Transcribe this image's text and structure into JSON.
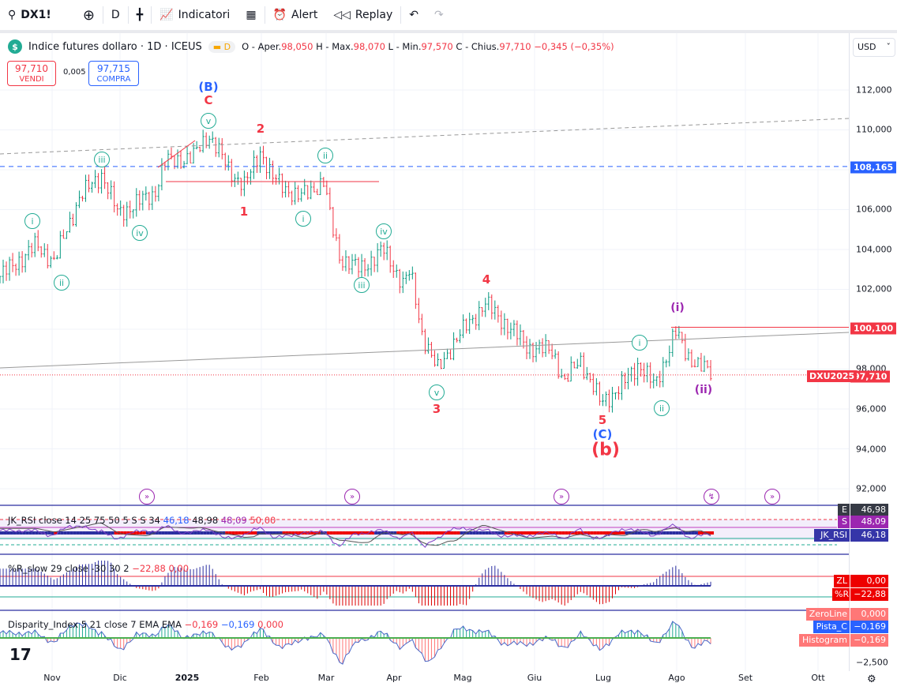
{
  "toolbar": {
    "symbol": "DX1!",
    "interval": "D",
    "indicators": "Indicatori",
    "alert": "Alert",
    "replay": "Replay"
  },
  "legend": {
    "title": "Indice futures dollaro · 1D · ICEUS",
    "badge": "D",
    "o_label": "O - Aper.",
    "o": "98,050",
    "h_label": "H - Max.",
    "h": "98,070",
    "l_label": "L - Min.",
    "l": "97,570",
    "c_label": "C - Chius.",
    "c": "97,710",
    "change": "−0,345 (−0,35%)"
  },
  "trade": {
    "sell_price": "97,710",
    "sell_label": "VENDI",
    "spread": "0,005",
    "buy_price": "97,715",
    "buy_label": "COMPRA"
  },
  "axis": {
    "currency": "USD",
    "ticks": [
      "112,000",
      "110,000",
      "106,000",
      "104,000",
      "102,000",
      "98,000",
      "96,000",
      "94,000",
      "92,000"
    ],
    "tag_blue": "108,165",
    "tag_red": "100,100",
    "tag_last": "97,710",
    "contract": "DXU2025"
  },
  "time_axis": [
    "Nov",
    "Dic",
    "2025",
    "Feb",
    "Mar",
    "Apr",
    "Mag",
    "Giu",
    "Lug",
    "Ago",
    "Set",
    "Ott"
  ],
  "waves": {
    "B": "(B)",
    "C": "C",
    "v1": "v",
    "n2": "2",
    "iii1": "iii",
    "ii1": "ii",
    "n1": "1",
    "i1": "i",
    "i2": "i",
    "iv1": "iv",
    "iv2": "iv",
    "ii2": "ii",
    "iii2": "iii",
    "n4": "4",
    "v2": "v",
    "n3": "3",
    "n5": "5",
    "Cw": "(C)",
    "b": "(b)",
    "i3": "i",
    "ip": "(i)",
    "ii3": "ii",
    "iip": "(ii)"
  },
  "rsi": {
    "label": "JK_RSI close 14 25 75 50 5 S S 34",
    "v1": "46,18",
    "v2": "48,98",
    "v3": "48,09",
    "v4": "50,00",
    "tag_e": "E",
    "tag_e_val": "46,98",
    "tag_s": "S",
    "tag_s_val": "48,09",
    "tag_rsi": "JK_RSI",
    "tag_rsi_val": "46,18"
  },
  "wr": {
    "label": "%R_slow 29 close -30 30 2",
    "v1": "−22,88",
    "v2": "0,00",
    "tag_zl": "ZL",
    "tag_zl_val": "0,00",
    "tag_r": "%R",
    "tag_r_val": "−22,88"
  },
  "disp": {
    "label": "Disparity_Index 5 21 close 7 EMA EMA",
    "v1": "−0,169",
    "v2": "−0,169",
    "v3": "0,000",
    "tag_zero": "ZeroLine",
    "tag_zero_val": "0,000",
    "tag_pista": "Pista_C",
    "tag_pista_val": "−0,169",
    "tag_hist": "Histogram",
    "tag_hist_val": "−0,169",
    "tick": "−2,500"
  },
  "colors": {
    "up": "#089981",
    "down": "#f23645",
    "blue": "#2962ff"
  },
  "chart_data": {
    "type": "ohlc",
    "title": "Indice futures dollaro · 1D · ICEUS",
    "ylim": [
      91,
      113.5
    ],
    "waypoints_day": [
      0,
      16,
      24,
      35,
      45,
      52,
      68,
      73,
      85,
      92,
      101,
      108,
      115,
      120,
      132,
      143,
      146,
      150,
      159,
      169,
      178,
      181,
      186,
      193,
      200,
      214,
      223,
      233,
      244,
      249,
      256,
      265,
      274,
      282,
      289,
      298,
      303,
      314
    ],
    "waypoints_price": [
      102.65,
      104.2,
      103.4,
      106.6,
      107.8,
      105.8,
      106.8,
      108.4,
      108.6,
      109.8,
      108.0,
      107.2,
      109.0,
      107.6,
      106.6,
      107.4,
      105.4,
      103.6,
      103.0,
      104.0,
      102.3,
      102.9,
      99.9,
      97.9,
      99.3,
      101.3,
      100.3,
      99.1,
      98.9,
      97.3,
      98.5,
      96.3,
      97.1,
      98.3,
      97.1,
      99.9,
      98.7,
      97.71
    ],
    "levels": [
      108.165,
      100.1
    ]
  }
}
